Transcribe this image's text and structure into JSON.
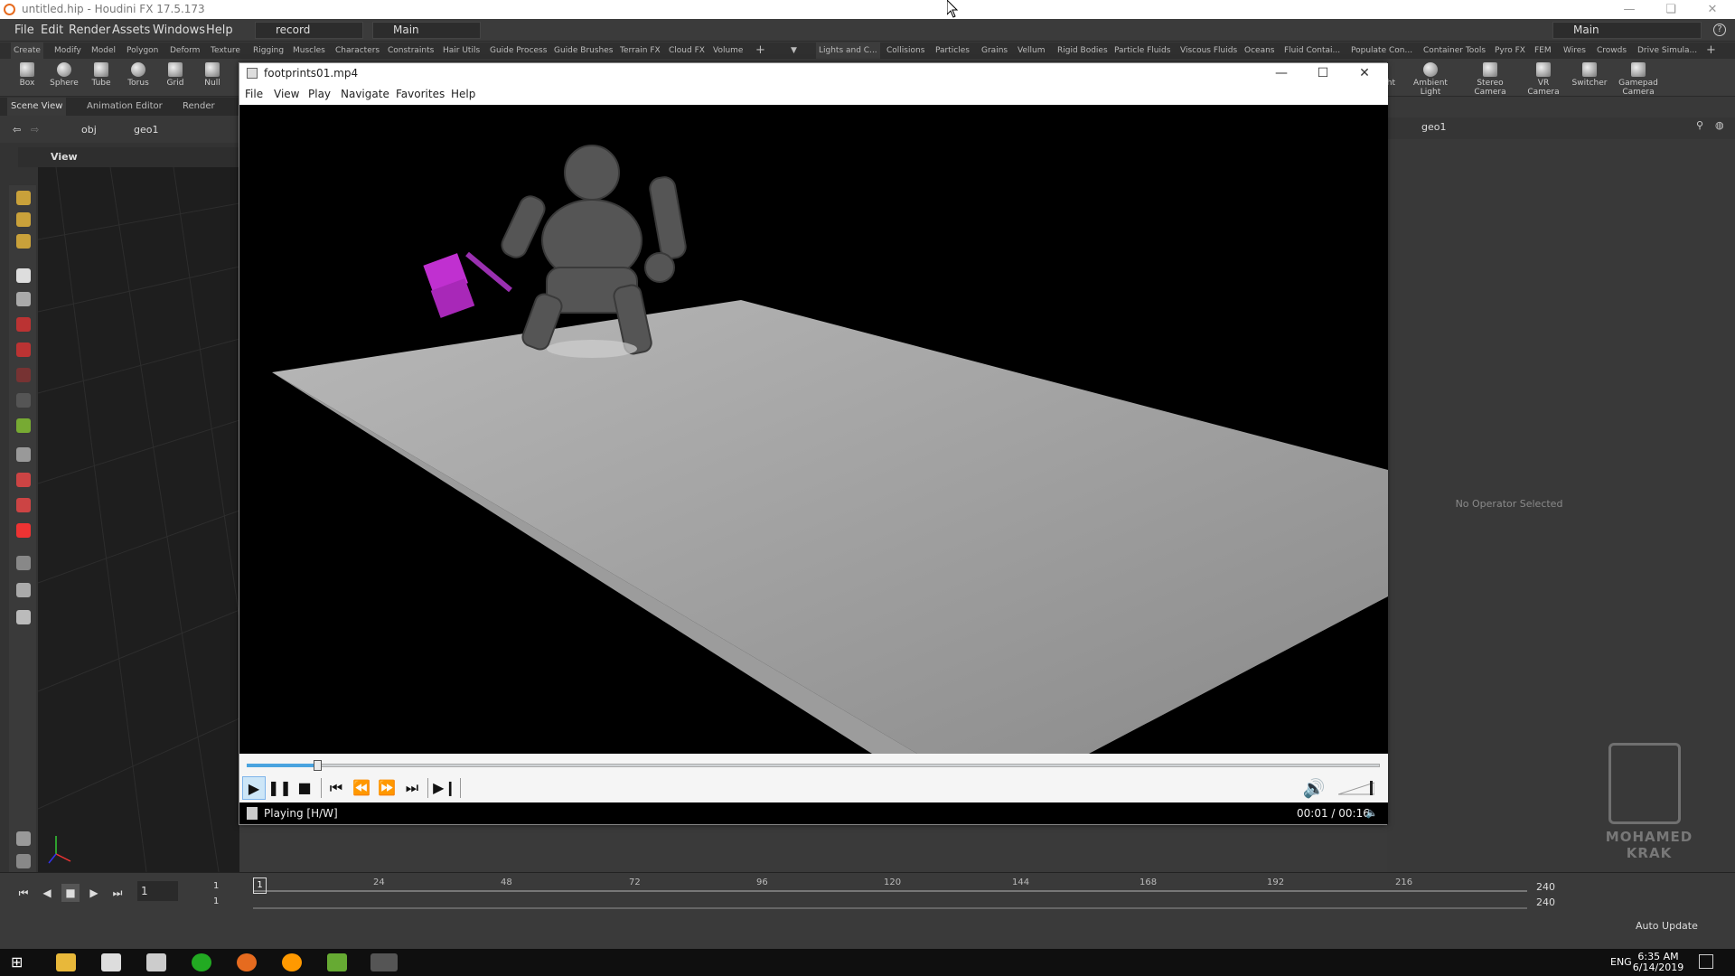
{
  "titlebar": {
    "title": "untitled.hip - Houdini FX 17.5.173"
  },
  "menubar": {
    "items": [
      "File",
      "Edit",
      "Render",
      "Assets",
      "Windows",
      "Help"
    ],
    "desktop": "record",
    "context": "Main",
    "right_desktop": "Main"
  },
  "shelf": {
    "tabs_left": [
      "Create",
      "Modify",
      "Model",
      "Polygon",
      "Deform",
      "Texture",
      "Rigging",
      "Muscles",
      "Characters",
      "Constraints",
      "Hair Utils",
      "Guide Process",
      "Guide Brushes",
      "Terrain FX",
      "Cloud FX",
      "Volume"
    ],
    "tabs_right": [
      "Lights and C...",
      "Collisions",
      "Particles",
      "Grains",
      "Vellum",
      "Rigid Bodies",
      "Particle Fluids",
      "Viscous Fluids",
      "Oceans",
      "Fluid Contai...",
      "Populate Con...",
      "Container Tools",
      "Pyro FX",
      "FEM",
      "Wires",
      "Crowds",
      "Drive Simula..."
    ],
    "tools_left": [
      "Box",
      "Sphere",
      "Tube",
      "Torus",
      "Grid",
      "Null"
    ],
    "tools_right": [
      "ht",
      "Ambient Light",
      "Stereo Camera",
      "VR Camera",
      "Switcher",
      "Gamepad Camera"
    ]
  },
  "left_pane": {
    "tabs": [
      "Scene View",
      "Animation Editor",
      "Render View"
    ],
    "path": [
      "obj",
      "geo1"
    ],
    "view_label": "View"
  },
  "right_pane": {
    "path": "geo1",
    "empty_message": "No Operator Selected"
  },
  "player": {
    "title": "footprints01.mp4",
    "menu": [
      "File",
      "View",
      "Play",
      "Navigate",
      "Favorites",
      "Help"
    ],
    "status": "Playing [H/W]",
    "time": "00:01 / 00:16",
    "progress": 0.0625
  },
  "timeline": {
    "current_frame": "1",
    "range_start": "1",
    "range_start2": "1",
    "ticks": [
      "24",
      "48",
      "72",
      "96",
      "120",
      "144",
      "168",
      "192",
      "216"
    ],
    "end": "240",
    "end2": "240",
    "update_mode": "Auto Update",
    "playhead_label": "1"
  },
  "taskbar": {
    "lang": "ENG",
    "time": "6:35 AM",
    "date": "6/14/2019"
  },
  "watermark": {
    "text": "MOHAMED KRAK"
  },
  "colors": {
    "accent": "#7eb4ea",
    "houdini_orange": "#e66b1f",
    "magenta": "#c030d0"
  }
}
